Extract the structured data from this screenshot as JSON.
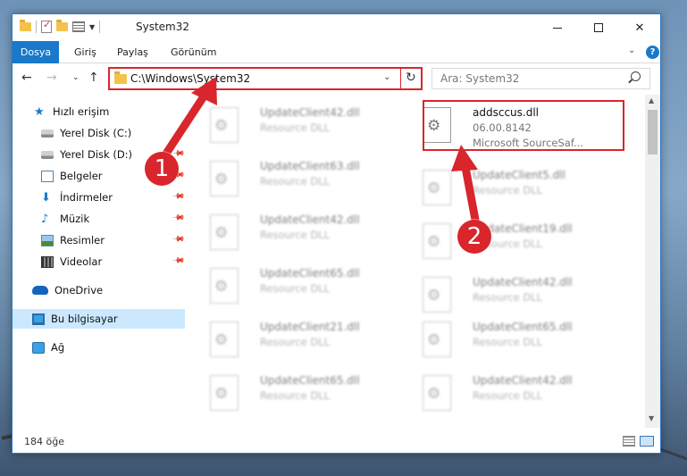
{
  "window": {
    "title": "System32",
    "controls": {
      "minimize": "—",
      "maximize": "☐",
      "close": "✕"
    }
  },
  "ribbon": {
    "tabs": [
      "Dosya",
      "Giriş",
      "Paylaş",
      "Görünüm"
    ],
    "help": "?"
  },
  "navbar": {
    "address": "C:\\Windows\\System32",
    "search_placeholder": "Ara: System32"
  },
  "sidebar": {
    "items": [
      {
        "label": "Hızlı erişim",
        "icon": "star-icon"
      },
      {
        "label": "Yerel Disk (C:)",
        "icon": "disk-icon"
      },
      {
        "label": "Yerel Disk (D:)",
        "icon": "disk-icon"
      },
      {
        "label": "Belgeler",
        "icon": "documents-icon",
        "pinned": true
      },
      {
        "label": "İndirmeler",
        "icon": "downloads-icon",
        "pinned": true
      },
      {
        "label": "Müzik",
        "icon": "music-icon",
        "pinned": true
      },
      {
        "label": "Resimler",
        "icon": "pictures-icon",
        "pinned": true
      },
      {
        "label": "Videolar",
        "icon": "videos-icon",
        "pinned": true
      },
      {
        "label": "OneDrive",
        "icon": "onedrive-icon"
      },
      {
        "label": "Bu bilgisayar",
        "icon": "this-pc-icon",
        "selected": true
      },
      {
        "label": "Ağ",
        "icon": "network-icon"
      }
    ]
  },
  "files": {
    "left_column": [
      {
        "name": "UpdateClient42.dll",
        "type": "Resource DLL"
      },
      {
        "name": "UpdateClient63.dll",
        "type": "Resource DLL"
      },
      {
        "name": "UpdateClient42.dll",
        "type": "Resource DLL"
      },
      {
        "name": "UpdateClient65.dll",
        "type": "Resource DLL"
      },
      {
        "name": "UpdateClient21.dll",
        "type": "Resource DLL"
      },
      {
        "name": "UpdateClient65.dll",
        "type": "Resource DLL"
      }
    ],
    "right_column": [
      {
        "name": "UpdateClient5.dll",
        "type": "Resource DLL"
      },
      {
        "name": "UpdateClient19.dll",
        "type": "Resource DLL"
      },
      {
        "name": "UpdateClient42.dll",
        "type": "Resource DLL"
      },
      {
        "name": "UpdateClient65.dll",
        "type": "Resource DLL"
      },
      {
        "name": "UpdateClient42.dll",
        "type": "Resource DLL"
      }
    ],
    "highlighted": {
      "name": "addsccus.dll",
      "version": "06.00.8142",
      "company": "Microsoft SourceSaf..."
    }
  },
  "status": {
    "item_count": "184 öğe"
  },
  "callouts": {
    "first": "1",
    "second": "2"
  },
  "colors": {
    "accent": "#1979ca",
    "annotation_red": "#d9252c",
    "selection": "#cce8ff"
  }
}
